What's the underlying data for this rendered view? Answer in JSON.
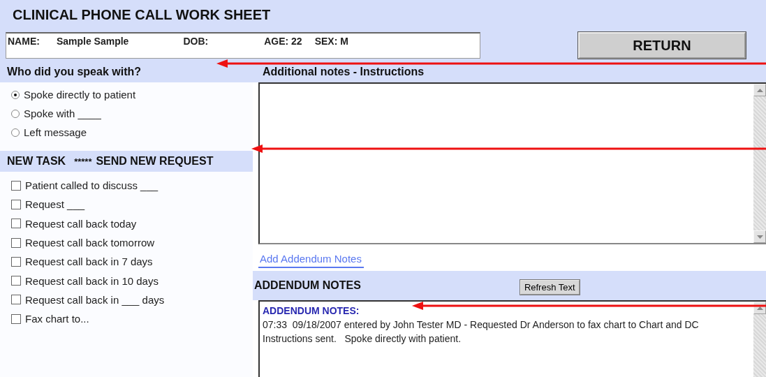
{
  "title": "CLINICAL PHONE CALL WORK SHEET",
  "patient": [
    {
      "label": "NAME:",
      "value": "Sample Sample"
    },
    {
      "label": "DOB:"
    },
    {
      "label": "AGE: 22"
    },
    {
      "label": "SEX: M"
    }
  ],
  "return_button": "RETURN",
  "speak_section": {
    "heading": "Who did you speak with?",
    "options": [
      {
        "label": "Spoke directly to patient",
        "selected": true
      },
      {
        "label": "Spoke with ____",
        "selected": false
      },
      {
        "label": "Left message",
        "selected": false
      }
    ]
  },
  "task_section": {
    "heading": "NEW TASK",
    "stars": "*****",
    "heading_2": "SEND NEW REQUEST",
    "items": [
      {
        "label": "Patient called to discuss ___",
        "checked": false
      },
      {
        "label": "Request ___",
        "checked": false
      },
      {
        "label": "Request call back today",
        "checked": false
      },
      {
        "label": "Request call back tomorrow",
        "checked": false
      },
      {
        "label": "Request call back in 7 days",
        "checked": false
      },
      {
        "label": "Request call back in 10 days",
        "checked": false
      },
      {
        "label": "Request call back in ___ days",
        "checked": false
      },
      {
        "label": "Fax chart to...",
        "checked": false
      }
    ]
  },
  "notes": {
    "heading": "Additional notes - Instructions"
  },
  "addendum_tab": {
    "label": "Add Addendum Notes",
    "selected": true
  },
  "addendum": {
    "heading": "ADDENDUM NOTES",
    "refresh_button": "Refresh Text",
    "text_heading": "ADDENDUM NOTES:",
    "text": "07:33  09/18/2007 entered by John Tester MD - Requested Dr Anderson to fax chart to Chart and DC Instructions sent.   Spoke directly with patient."
  }
}
